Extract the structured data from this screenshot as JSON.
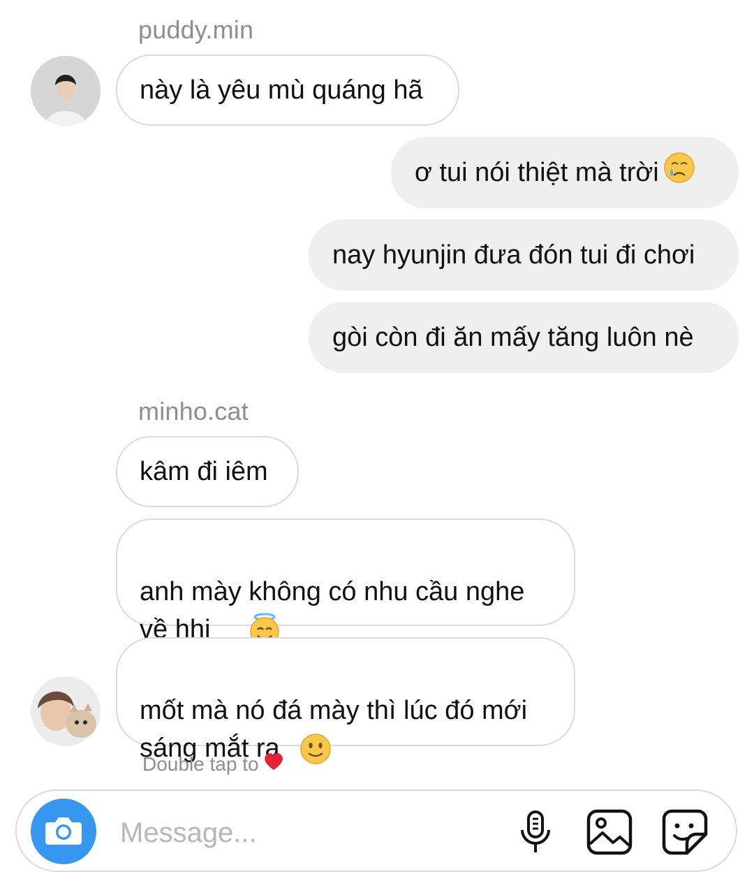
{
  "thread": {
    "groups": [
      {
        "sender": "puddy.min",
        "messages": [
          "này là yêu mù quáng hã"
        ]
      },
      {
        "sender": "me",
        "messages": [
          "ơ tui nói thiệt mà trời",
          "nay hyunjin đưa đón tui đi chơi",
          "gòi còn đi ăn mấy tăng luôn nè"
        ]
      },
      {
        "sender": "minho.cat",
        "messages": [
          "kâm đi iêm",
          "anh mày không có nhu cầu nghe\nvề hhj",
          "mốt mà nó đá mày thì lúc đó mới\nsáng mắt ra"
        ]
      }
    ],
    "emojis": {
      "crying-face": "crying-face-icon",
      "halo-face": "smiling-face-with-halo-icon",
      "slight-smile": "slightly-smiling-face-icon"
    }
  },
  "hint": {
    "text": "Double tap to",
    "icon": "red-heart-icon"
  },
  "composer": {
    "placeholder": "Message...",
    "icons": [
      "camera-icon",
      "microphone-icon",
      "gallery-icon",
      "sticker-icon"
    ]
  },
  "colors": {
    "accent": "#3797f0",
    "bubble_out": "#efefef",
    "bubble_in_border": "#dbdbdb",
    "meta_text": "#8e8e8e",
    "heart": "#e8203a"
  }
}
